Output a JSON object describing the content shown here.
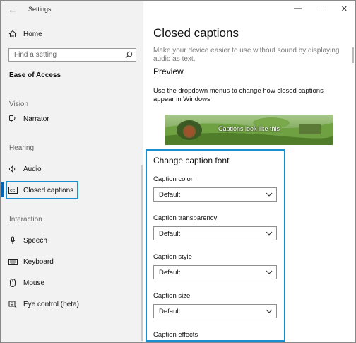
{
  "window": {
    "title": "Settings",
    "controls": {
      "minimize": "—",
      "maximize": "☐",
      "close": "✕"
    }
  },
  "sidebar": {
    "home_label": "Home",
    "search_placeholder": "Find a setting",
    "category": "Ease of Access",
    "sections": {
      "vision": "Vision",
      "hearing": "Hearing",
      "interaction": "Interaction"
    },
    "items": {
      "narrator": "Narrator",
      "audio": "Audio",
      "closed_captions": "Closed captions",
      "speech": "Speech",
      "keyboard": "Keyboard",
      "mouse": "Mouse",
      "eye_control": "Eye control (beta)"
    },
    "active_item": "Closed captions"
  },
  "main": {
    "title": "Closed captions",
    "description": "Make your device easier to use without sound by displaying audio as text.",
    "preview_heading": "Preview",
    "preview_text": "Use the dropdown menus to change how closed captions appear in Windows",
    "caption_sample": "Captions look like this",
    "font_group_title": "Change caption font",
    "fields": [
      {
        "label": "Caption color",
        "value": "Default"
      },
      {
        "label": "Caption transparency",
        "value": "Default"
      },
      {
        "label": "Caption style",
        "value": "Default"
      },
      {
        "label": "Caption size",
        "value": "Default"
      }
    ],
    "next_label": "Caption effects"
  },
  "colors": {
    "accent": "#0063b1",
    "highlight": "#1a8fd0",
    "sidebar_bg": "#f2f2f2"
  }
}
